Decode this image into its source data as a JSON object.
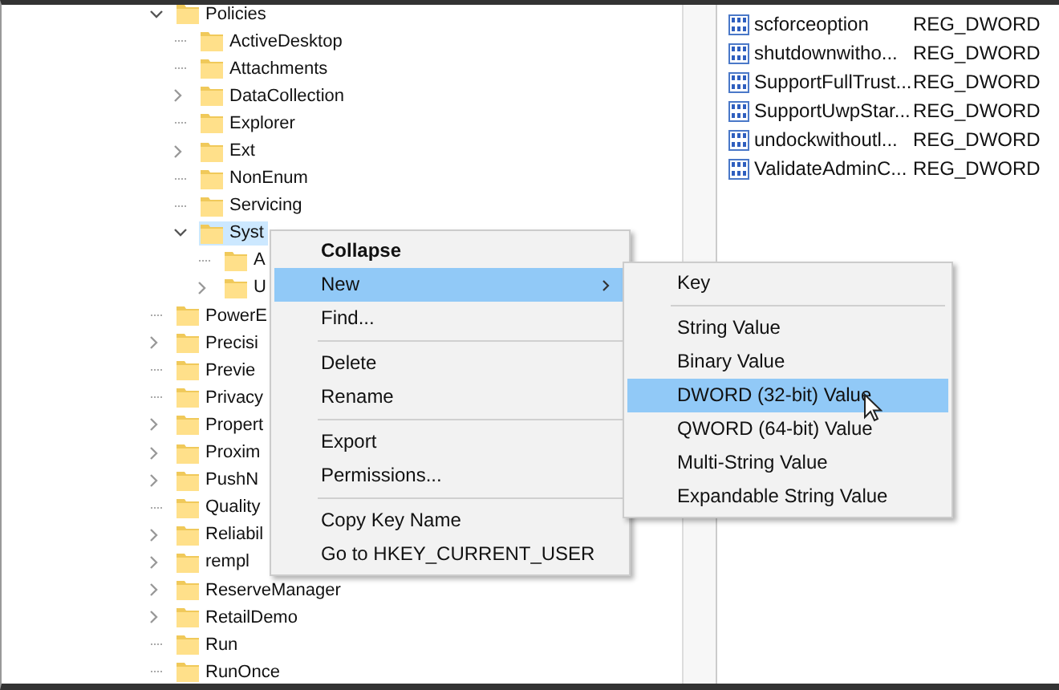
{
  "tree": [
    {
      "label": "Policies",
      "kind": "branch",
      "expanded": true,
      "selected": false,
      "children": [
        {
          "label": "ActiveDesktop",
          "kind": "leaf",
          "selected": false
        },
        {
          "label": "Attachments",
          "kind": "leaf",
          "selected": false
        },
        {
          "label": "DataCollection",
          "kind": "branch",
          "expanded": false,
          "selected": false
        },
        {
          "label": "Explorer",
          "kind": "leaf",
          "selected": false
        },
        {
          "label": "Ext",
          "kind": "branch",
          "expanded": false,
          "selected": false
        },
        {
          "label": "NonEnum",
          "kind": "leaf",
          "selected": false
        },
        {
          "label": "Servicing",
          "kind": "leaf",
          "selected": false
        },
        {
          "label": "Syst",
          "kind": "branch",
          "expanded": true,
          "selected": true,
          "children": [
            {
              "label": "A",
              "kind": "leaf",
              "selected": false
            },
            {
              "label": "U",
              "kind": "branch",
              "expanded": false,
              "selected": false
            }
          ]
        }
      ]
    },
    {
      "label": "PowerE",
      "kind": "leaf",
      "selected": false
    },
    {
      "label": "Precisi",
      "kind": "branch",
      "expanded": false,
      "selected": false
    },
    {
      "label": "Previe",
      "kind": "leaf",
      "selected": false
    },
    {
      "label": "Privacy",
      "kind": "leaf",
      "selected": false
    },
    {
      "label": "Propert",
      "kind": "branch",
      "expanded": false,
      "selected": false
    },
    {
      "label": "Proxim",
      "kind": "branch",
      "expanded": false,
      "selected": false
    },
    {
      "label": "PushN",
      "kind": "branch",
      "expanded": false,
      "selected": false
    },
    {
      "label": "Quality",
      "kind": "leaf",
      "selected": false
    },
    {
      "label": "Reliabil",
      "kind": "branch",
      "expanded": false,
      "selected": false
    },
    {
      "label": "rempl",
      "kind": "branch",
      "expanded": false,
      "selected": false
    },
    {
      "label": "ReserveManager",
      "kind": "branch",
      "expanded": false,
      "selected": false
    },
    {
      "label": "RetailDemo",
      "kind": "branch",
      "expanded": false,
      "selected": false
    },
    {
      "label": "Run",
      "kind": "leaf",
      "selected": false
    },
    {
      "label": "RunOnce",
      "kind": "leaf",
      "selected": false
    }
  ],
  "values": [
    {
      "name": "scforceoption",
      "type": "REG_DWORD"
    },
    {
      "name": "shutdownwitho...",
      "type": "REG_DWORD"
    },
    {
      "name": "SupportFullTrust...",
      "type": "REG_DWORD"
    },
    {
      "name": "SupportUwpStar...",
      "type": "REG_DWORD"
    },
    {
      "name": "undockwithoutl...",
      "type": "REG_DWORD"
    },
    {
      "name": "ValidateAdminC...",
      "type": "REG_DWORD"
    }
  ],
  "context_menu": {
    "groups": [
      [
        {
          "label": "Collapse",
          "default": true,
          "has_submenu": false,
          "selected": false
        },
        {
          "label": "New",
          "default": false,
          "has_submenu": true,
          "selected": true
        },
        {
          "label": "Find...",
          "default": false,
          "has_submenu": false,
          "selected": false
        }
      ],
      [
        {
          "label": "Delete",
          "default": false,
          "has_submenu": false,
          "selected": false
        },
        {
          "label": "Rename",
          "default": false,
          "has_submenu": false,
          "selected": false
        }
      ],
      [
        {
          "label": "Export",
          "default": false,
          "has_submenu": false,
          "selected": false
        },
        {
          "label": "Permissions...",
          "default": false,
          "has_submenu": false,
          "selected": false
        }
      ],
      [
        {
          "label": "Copy Key Name",
          "default": false,
          "has_submenu": false,
          "selected": false
        },
        {
          "label": "Go to HKEY_CURRENT_USER",
          "default": false,
          "has_submenu": false,
          "selected": false
        }
      ]
    ]
  },
  "submenu": {
    "groups": [
      [
        {
          "label": "Key",
          "selected": false
        }
      ],
      [
        {
          "label": "String Value",
          "selected": false
        },
        {
          "label": "Binary Value",
          "selected": false
        },
        {
          "label": "DWORD (32-bit) Value",
          "selected": true
        },
        {
          "label": "QWORD (64-bit) Value",
          "selected": false
        },
        {
          "label": "Multi-String Value",
          "selected": false
        },
        {
          "label": "Expandable String Value",
          "selected": false
        }
      ]
    ]
  }
}
